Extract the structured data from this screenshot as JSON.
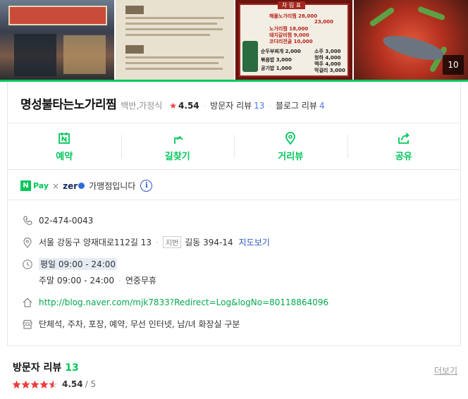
{
  "photos": {
    "count_badge": "10",
    "menu_title": "차 림 표",
    "menu_rows": [
      "해물노가리찜  28,000",
      "23,000",
      "노가리찜  18,000",
      "돼지갈비찜  9,000",
      "코다리전골  10,000",
      "순두부찌개  2,000",
      "볶음밥  3,000",
      "공기밥  1,000",
      "소주  3,000",
      "청하  4,000",
      "맥주  4,000",
      "막걸리  3,000"
    ]
  },
  "place": {
    "name": "명성불타는노가리찜",
    "category": "백반,가정식",
    "rating": "4.54",
    "visitor_reviews_label": "방문자 리뷰",
    "visitor_reviews_count": "13",
    "blog_reviews_label": "블로그 리뷰",
    "blog_reviews_count": "4"
  },
  "actions": [
    {
      "label": "예약",
      "icon": "naver-booking-icon"
    },
    {
      "label": "길찾기",
      "icon": "directions-icon"
    },
    {
      "label": "거리뷰",
      "icon": "street-view-icon"
    },
    {
      "label": "공유",
      "icon": "share-icon"
    }
  ],
  "pay": {
    "npay_mark": "N",
    "npay_text": "Pay",
    "times": "×",
    "zero_text": "zer",
    "description": "가맹점입니다",
    "info_glyph": "i"
  },
  "info": {
    "phone": "02-474-0043",
    "address": "서울 강동구 양재대로112길 13",
    "jibeon_label": "지번",
    "jibeon_address": "길동 394-14",
    "map_link": "지도보기",
    "hours_weekday": "평일 09:00 - 24:00",
    "hours_weekend": "주말 09:00 - 24:00",
    "hours_note": "연중무휴",
    "homepage": "http://blog.naver.com/mjk7833?Redirect=Log&logNo=80118864096",
    "amenities": "단체석, 주차, 포장, 예약, 무선 인터넷, 남/녀 화장실 구분"
  },
  "review_section": {
    "title": "방문자 리뷰",
    "count": "13",
    "more": "더보기",
    "score": "4.54",
    "out_of": "/ 5",
    "stars_value": 4.54
  },
  "colors": {
    "accent": "#03c75a",
    "star": "#f23c3c",
    "link": "#3158c9"
  }
}
